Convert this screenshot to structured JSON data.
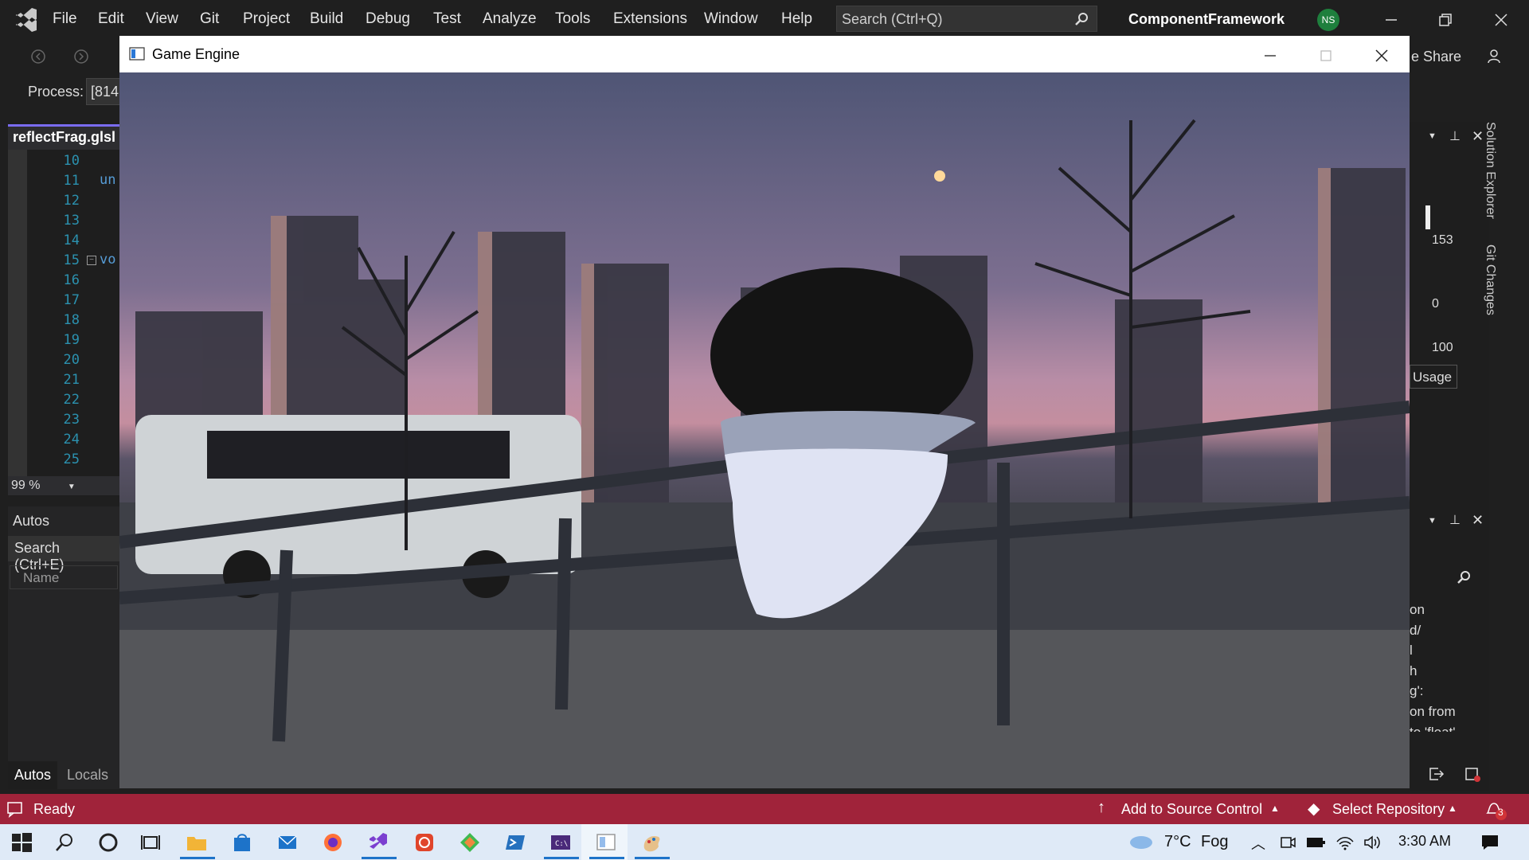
{
  "menubar": {
    "items": [
      "File",
      "Edit",
      "View",
      "Git",
      "Project",
      "Build",
      "Debug",
      "Test",
      "Analyze",
      "Tools",
      "Extensions",
      "Window",
      "Help"
    ],
    "search_placeholder": "Search (Ctrl+Q)",
    "project_name": "ComponentFramework",
    "avatar_initials": "NS"
  },
  "toolbar": {
    "share_label": "e Share",
    "process_label": "Process:",
    "process_value": "[814"
  },
  "editor": {
    "tab_label": "reflectFrag.glsl",
    "line_numbers": [
      "10",
      "11",
      "12",
      "13",
      "14",
      "15",
      "16",
      "17",
      "18",
      "19",
      "20",
      "21",
      "22",
      "23",
      "24",
      "25"
    ],
    "code_line_11": "un",
    "code_line_15": "vo",
    "zoom": "99 %"
  },
  "autos_panel": {
    "title": "Autos",
    "search_placeholder": "Search (Ctrl+E)",
    "column_name": "Name",
    "tab_autos": "Autos",
    "tab_locals": "Locals"
  },
  "game_window": {
    "title": "Game Engine"
  },
  "right_panel": {
    "values": [
      "153",
      "0",
      "100"
    ],
    "usage_label": "Usage",
    "output_lines": [
      "on",
      "d/",
      "l",
      "h",
      "g':",
      "on from",
      "to 'float'"
    ]
  },
  "vertical_tabs": [
    "Solution Explorer",
    "Git Changes"
  ],
  "statusbar": {
    "ready": "Ready",
    "source_control": "Add to Source Control",
    "repository": "Select Repository",
    "notifications": "3"
  },
  "taskbar": {
    "weather_temp": "7°C",
    "weather_cond": "Fog",
    "time": "3:30 AM"
  },
  "colors": {
    "status_bar": "#a0233a",
    "taskbar": "#dfeaf7",
    "vs_dark": "#1f1f1f",
    "accent": "#7a6cf0"
  }
}
